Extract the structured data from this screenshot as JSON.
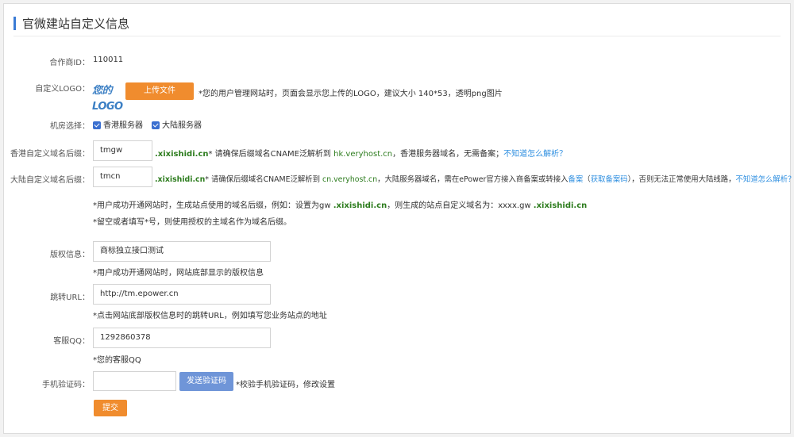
{
  "page": {
    "title": "官微建站自定义信息"
  },
  "partner": {
    "label": "合作商ID：",
    "value": "110011"
  },
  "logo": {
    "label": "自定义LOGO：",
    "image_text": "您的LOGO",
    "upload_label": "上传文件",
    "hint": "*您的用户管理网站时，页面会显示您上传的LOGO，建议大小 140*53，透明png图片"
  },
  "server": {
    "label": "机房选择：",
    "option_hk": "香港服务器",
    "option_cn": "大陆服务器"
  },
  "hk_domain": {
    "label": "香港自定义域名后缀：",
    "value": "tmgw",
    "suffix": ".xixishidi.cn",
    "hint_a": "* 请确保后缀域名CNAME泛解析到",
    "target": "hk.veryhost.cn",
    "hint_b": "，香港服务器域名，无需备案；",
    "help_link": "不知道怎么解析？"
  },
  "cn_domain": {
    "label": "大陆自定义域名后缀：",
    "value": "tmcn",
    "suffix": ".xixishidi.cn",
    "hint_a": "* 请确保后缀域名CNAME泛解析到",
    "target": "cn.veryhost.cn",
    "hint_b": "，大陆服务器域名，需在ePower官方接入商备案或转接入",
    "record_link": "备案",
    "paren_open": "（",
    "get_record_link": "获取备案码",
    "hint_c": "），否则无法正常使用大陆线路，",
    "help_link": "不知道怎么解析？"
  },
  "domain_notes": {
    "note1_a": "*用户成功开通网站时，生成站点使用的域名后缀，例如：设置为gw",
    "note1_suffix": ".xixishidi.cn",
    "note1_b": "，则生成的站点自定义域名为：xxxx.gw",
    "note1_suffix2": ".xixishidi.cn",
    "note2": "*留空或者填写*号，则使用授权的主域名作为域名后缀。"
  },
  "copyright": {
    "label": "版权信息：",
    "value": "商标独立接口测试",
    "hint": "*用户成功开通网站时，网站底部显示的版权信息"
  },
  "redirect": {
    "label": "跳转URL：",
    "value": "http://tm.epower.cn",
    "hint": "*点击网站底部版权信息时的跳转URL，例如填写您业务站点的地址"
  },
  "qq": {
    "label": "客服QQ：",
    "value": "1292860378",
    "hint": "*您的客服QQ"
  },
  "sms": {
    "label": "手机验证码：",
    "value": "",
    "send_label": "发送验证码",
    "hint": "*校验手机验证码，修改设置"
  },
  "submit": {
    "label": "提交"
  },
  "colors": {
    "accent": "#3a7bd5",
    "orange_button": "#f08c2e",
    "blue_button": "#6f95d8",
    "green_text": "#2e7d1f",
    "link": "#2f8fe0"
  }
}
